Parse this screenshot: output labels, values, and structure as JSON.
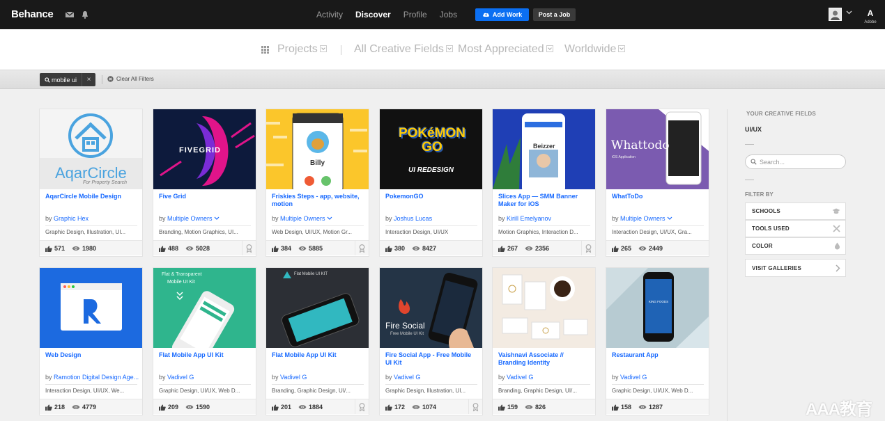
{
  "header": {
    "logo": "Behance",
    "nav": [
      "Activity",
      "Discover",
      "Profile",
      "Jobs"
    ],
    "active_nav": "Discover",
    "add_work": "Add Work",
    "post_job": "Post a Job",
    "adobe_label": "Adobe",
    "adobe_glyph": "A"
  },
  "filters": {
    "projects": "Projects",
    "fields": "All Creative Fields",
    "sort": "Most Appreciated",
    "location": "Worldwide"
  },
  "search_tag": {
    "query": "mobile ui",
    "remove": "×",
    "clear_all": "Clear All Filters"
  },
  "projects": [
    {
      "title": "AqarCircle Mobile Design",
      "by": "by",
      "owner": "Graphic Hex",
      "fields": "Graphic Design, Illustration, UI...",
      "likes": "571",
      "views": "1980",
      "owners_dropdown": false,
      "featured": false,
      "thumb": {
        "brand": "AqarCircle",
        "tagline": "For Property Search"
      }
    },
    {
      "title": "Five Grid",
      "by": "by",
      "owner": "Multiple Owners",
      "fields": "Branding, Motion Graphics, UI...",
      "likes": "488",
      "views": "5028",
      "owners_dropdown": true,
      "featured": true,
      "thumb": {
        "brand": "FIVEGRID",
        "tagline": ""
      }
    },
    {
      "title": "Friskies Steps - app, website, motion",
      "by": "by",
      "owner": "Multiple Owners",
      "fields": "Web Design, UI/UX, Motion Gr...",
      "likes": "384",
      "views": "5885",
      "owners_dropdown": true,
      "featured": true,
      "thumb": {
        "brand": "Billy",
        "tagline": ""
      }
    },
    {
      "title": "PokemonGO",
      "by": "by",
      "owner": "Joshus Lucas",
      "fields": "Interaction Design, UI/UX",
      "likes": "380",
      "views": "8427",
      "owners_dropdown": false,
      "featured": false,
      "thumb": {
        "brand": "POKéMON GO",
        "tagline": "UI REDESIGN"
      }
    },
    {
      "title": "Slices App — SMM Banner Maker for iOS",
      "by": "by",
      "owner": "Kirill Emelyanov",
      "fields": "Motion Graphics, Interaction D...",
      "likes": "267",
      "views": "2356",
      "owners_dropdown": false,
      "featured": true,
      "thumb": {
        "brand": "Beizzer",
        "tagline": ""
      }
    },
    {
      "title": "WhatToDo",
      "by": "by",
      "owner": "Multiple Owners",
      "fields": "Interaction Design, UI/UX, Gra...",
      "likes": "265",
      "views": "2449",
      "owners_dropdown": true,
      "featured": false,
      "thumb": {
        "brand": "Whattodo",
        "tagline": "iOS Application"
      }
    },
    {
      "title": "Web Design",
      "by": "by",
      "owner": "Ramotion Digital Design Age...",
      "fields": "Interaction Design, UI/UX, We...",
      "likes": "218",
      "views": "4779",
      "owners_dropdown": false,
      "featured": false,
      "thumb": {
        "brand": "",
        "tagline": ""
      }
    },
    {
      "title": "Flat Mobile App UI Kit",
      "by": "by",
      "owner": "Vadivel G",
      "fields": "Graphic Design, UI/UX, Web D...",
      "likes": "209",
      "views": "1590",
      "owners_dropdown": false,
      "featured": false,
      "thumb": {
        "brand": "Flat & Transparent",
        "tagline": "Mobile UI Kit"
      }
    },
    {
      "title": "Flat Mobile App UI Kit",
      "by": "by",
      "owner": "Vadivel G",
      "fields": "Branding, Graphic Design, UI/...",
      "likes": "201",
      "views": "1884",
      "owners_dropdown": false,
      "featured": true,
      "thumb": {
        "brand": "Flat Mobile UI KIT",
        "tagline": ""
      }
    },
    {
      "title": "Fire Social App - Free Mobile UI Kit",
      "by": "by",
      "owner": "Vadivel G",
      "fields": "Graphic Design, Illustration, UI...",
      "likes": "172",
      "views": "1074",
      "owners_dropdown": false,
      "featured": true,
      "thumb": {
        "brand": "Fire Social",
        "tagline": "Free Mobile UI Kit"
      }
    },
    {
      "title": "Vaishnavi Associate // Branding Identity",
      "by": "by",
      "owner": "Vadivel G",
      "fields": "Branding, Graphic Design, UI/...",
      "likes": "159",
      "views": "826",
      "owners_dropdown": false,
      "featured": false,
      "thumb": {
        "brand": "",
        "tagline": ""
      }
    },
    {
      "title": "Restaurant App",
      "by": "by",
      "owner": "Vadivel G",
      "fields": "Graphic Design, UI/UX, Web D...",
      "likes": "158",
      "views": "1287",
      "owners_dropdown": false,
      "featured": false,
      "thumb": {
        "brand": "KING FOODS",
        "tagline": ""
      }
    }
  ],
  "sidebar": {
    "your_fields_heading": "YOUR CREATIVE FIELDS",
    "field": "UI/UX",
    "search_placeholder": "Search...",
    "filter_by": "FILTER BY",
    "schools": "SCHOOLS",
    "tools": "TOOLS USED",
    "color": "COLOR",
    "galleries": "VISIT GALLERIES"
  },
  "watermark": "AAA教育",
  "colors": {
    "brand_blue": "#1769ff",
    "header_bg": "#191919",
    "add_work_bg": "#0b6ff2"
  }
}
